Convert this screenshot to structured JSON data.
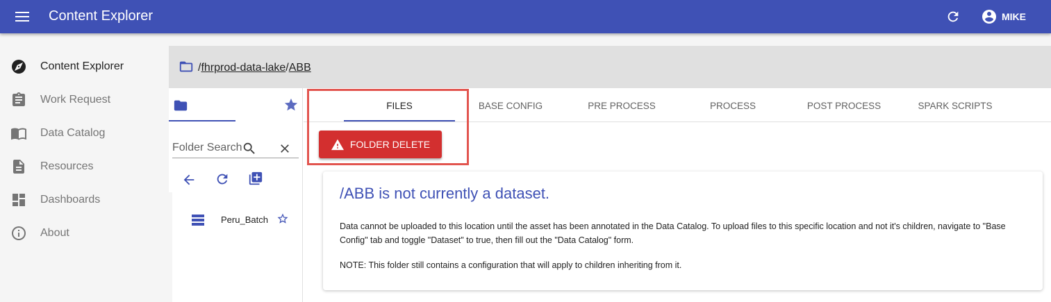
{
  "appbar": {
    "title": "Content Explorer",
    "user_label": "MIKE",
    "brand_color": "#3f51b5"
  },
  "sidebar": {
    "items": [
      {
        "label": "Content Explorer",
        "icon": "compass-icon"
      },
      {
        "label": "Work Request",
        "icon": "clipboard-icon"
      },
      {
        "label": "Data Catalog",
        "icon": "book-icon"
      },
      {
        "label": "Resources",
        "icon": "document-icon"
      },
      {
        "label": "Dashboards",
        "icon": "dashboard-icon"
      },
      {
        "label": "About",
        "icon": "info-icon"
      }
    ]
  },
  "path": {
    "separator": "/",
    "root": "fhrprod-data-lake",
    "current": "ABB"
  },
  "tree": {
    "search_placeholder": "Folder Search",
    "items": [
      {
        "label": "Peru_Batch",
        "icon": "list-icon"
      }
    ]
  },
  "tabs": [
    "FILES",
    "BASE CONFIG",
    "PRE PROCESS",
    "PROCESS",
    "POST PROCESS",
    "SPARK SCRIPTS"
  ],
  "actions": {
    "folder_delete_label": "FOLDER DELETE",
    "danger_color": "#d32f2f",
    "highlight_color": "#e2554f"
  },
  "notice": {
    "title": "/ABB is not currently a dataset.",
    "body": "Data cannot be uploaded to this location until the asset has been annotated in the Data Catalog. To upload files to this specific location and not it's children, navigate to \"Base Config\" tab and toggle \"Dataset\" to true, then fill out the \"Data Catalog\" form.",
    "note": "NOTE: This folder still contains a configuration that will apply to children inheriting from it."
  }
}
